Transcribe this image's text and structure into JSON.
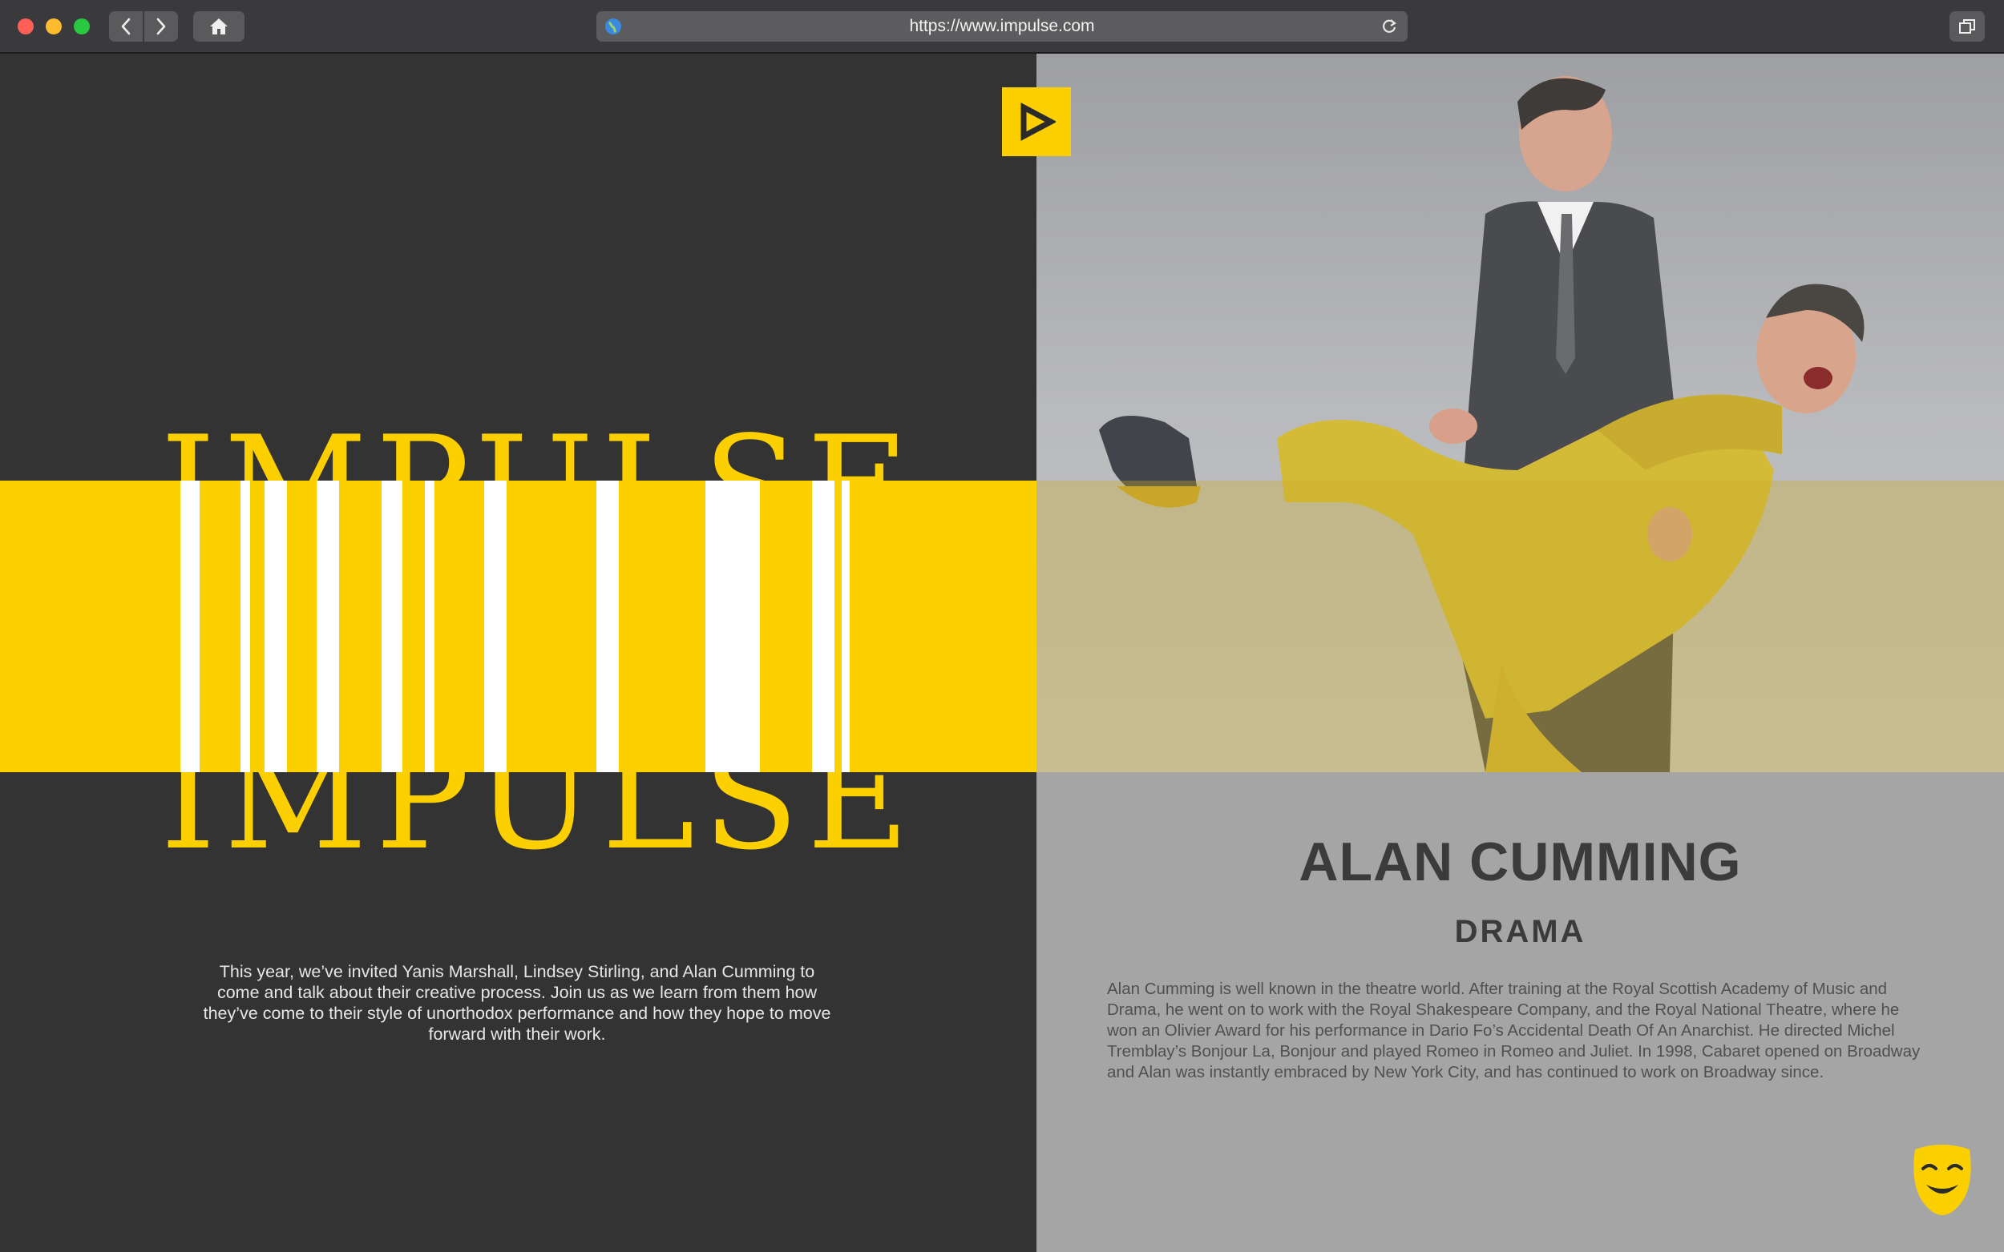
{
  "browser": {
    "url": "https://www.impulse.com"
  },
  "hero": {
    "wordmark": "IMPULSE",
    "intro": "This year, we’ve invited Yanis Marshall, Lindsey Stirling, and Alan Cumming to come and talk about their creative process. Join us as we learn from them how they’ve come to their style of unorthodox performance and how they hope to move forward with their work."
  },
  "artist": {
    "name": "ALAN CUMMING",
    "genre": "DRAMA",
    "bio": "Alan Cumming is well known in the theatre world. After training at the Royal Scottish Academy of Music and Drama, he went on to work with the Royal Shakespeare Company, and the Royal National Theatre, where he won an Olivier Award for his performance in Dario Fo’s Accidental Death Of An Anarchist. He directed Michel Tremblay’s Bonjour La, Bonjour and played Romeo in Romeo and Juliet. In 1998, Cabaret opened on Broadway and Alan was instantly embraced by New York City, and has continued to work on Broadway since."
  },
  "colors": {
    "accent": "#fccf00",
    "dark": "#333333",
    "grey": "#a5a5a5"
  },
  "icons": {
    "logo": "play-triangle-icon",
    "footer": "comedy-mask-icon"
  }
}
